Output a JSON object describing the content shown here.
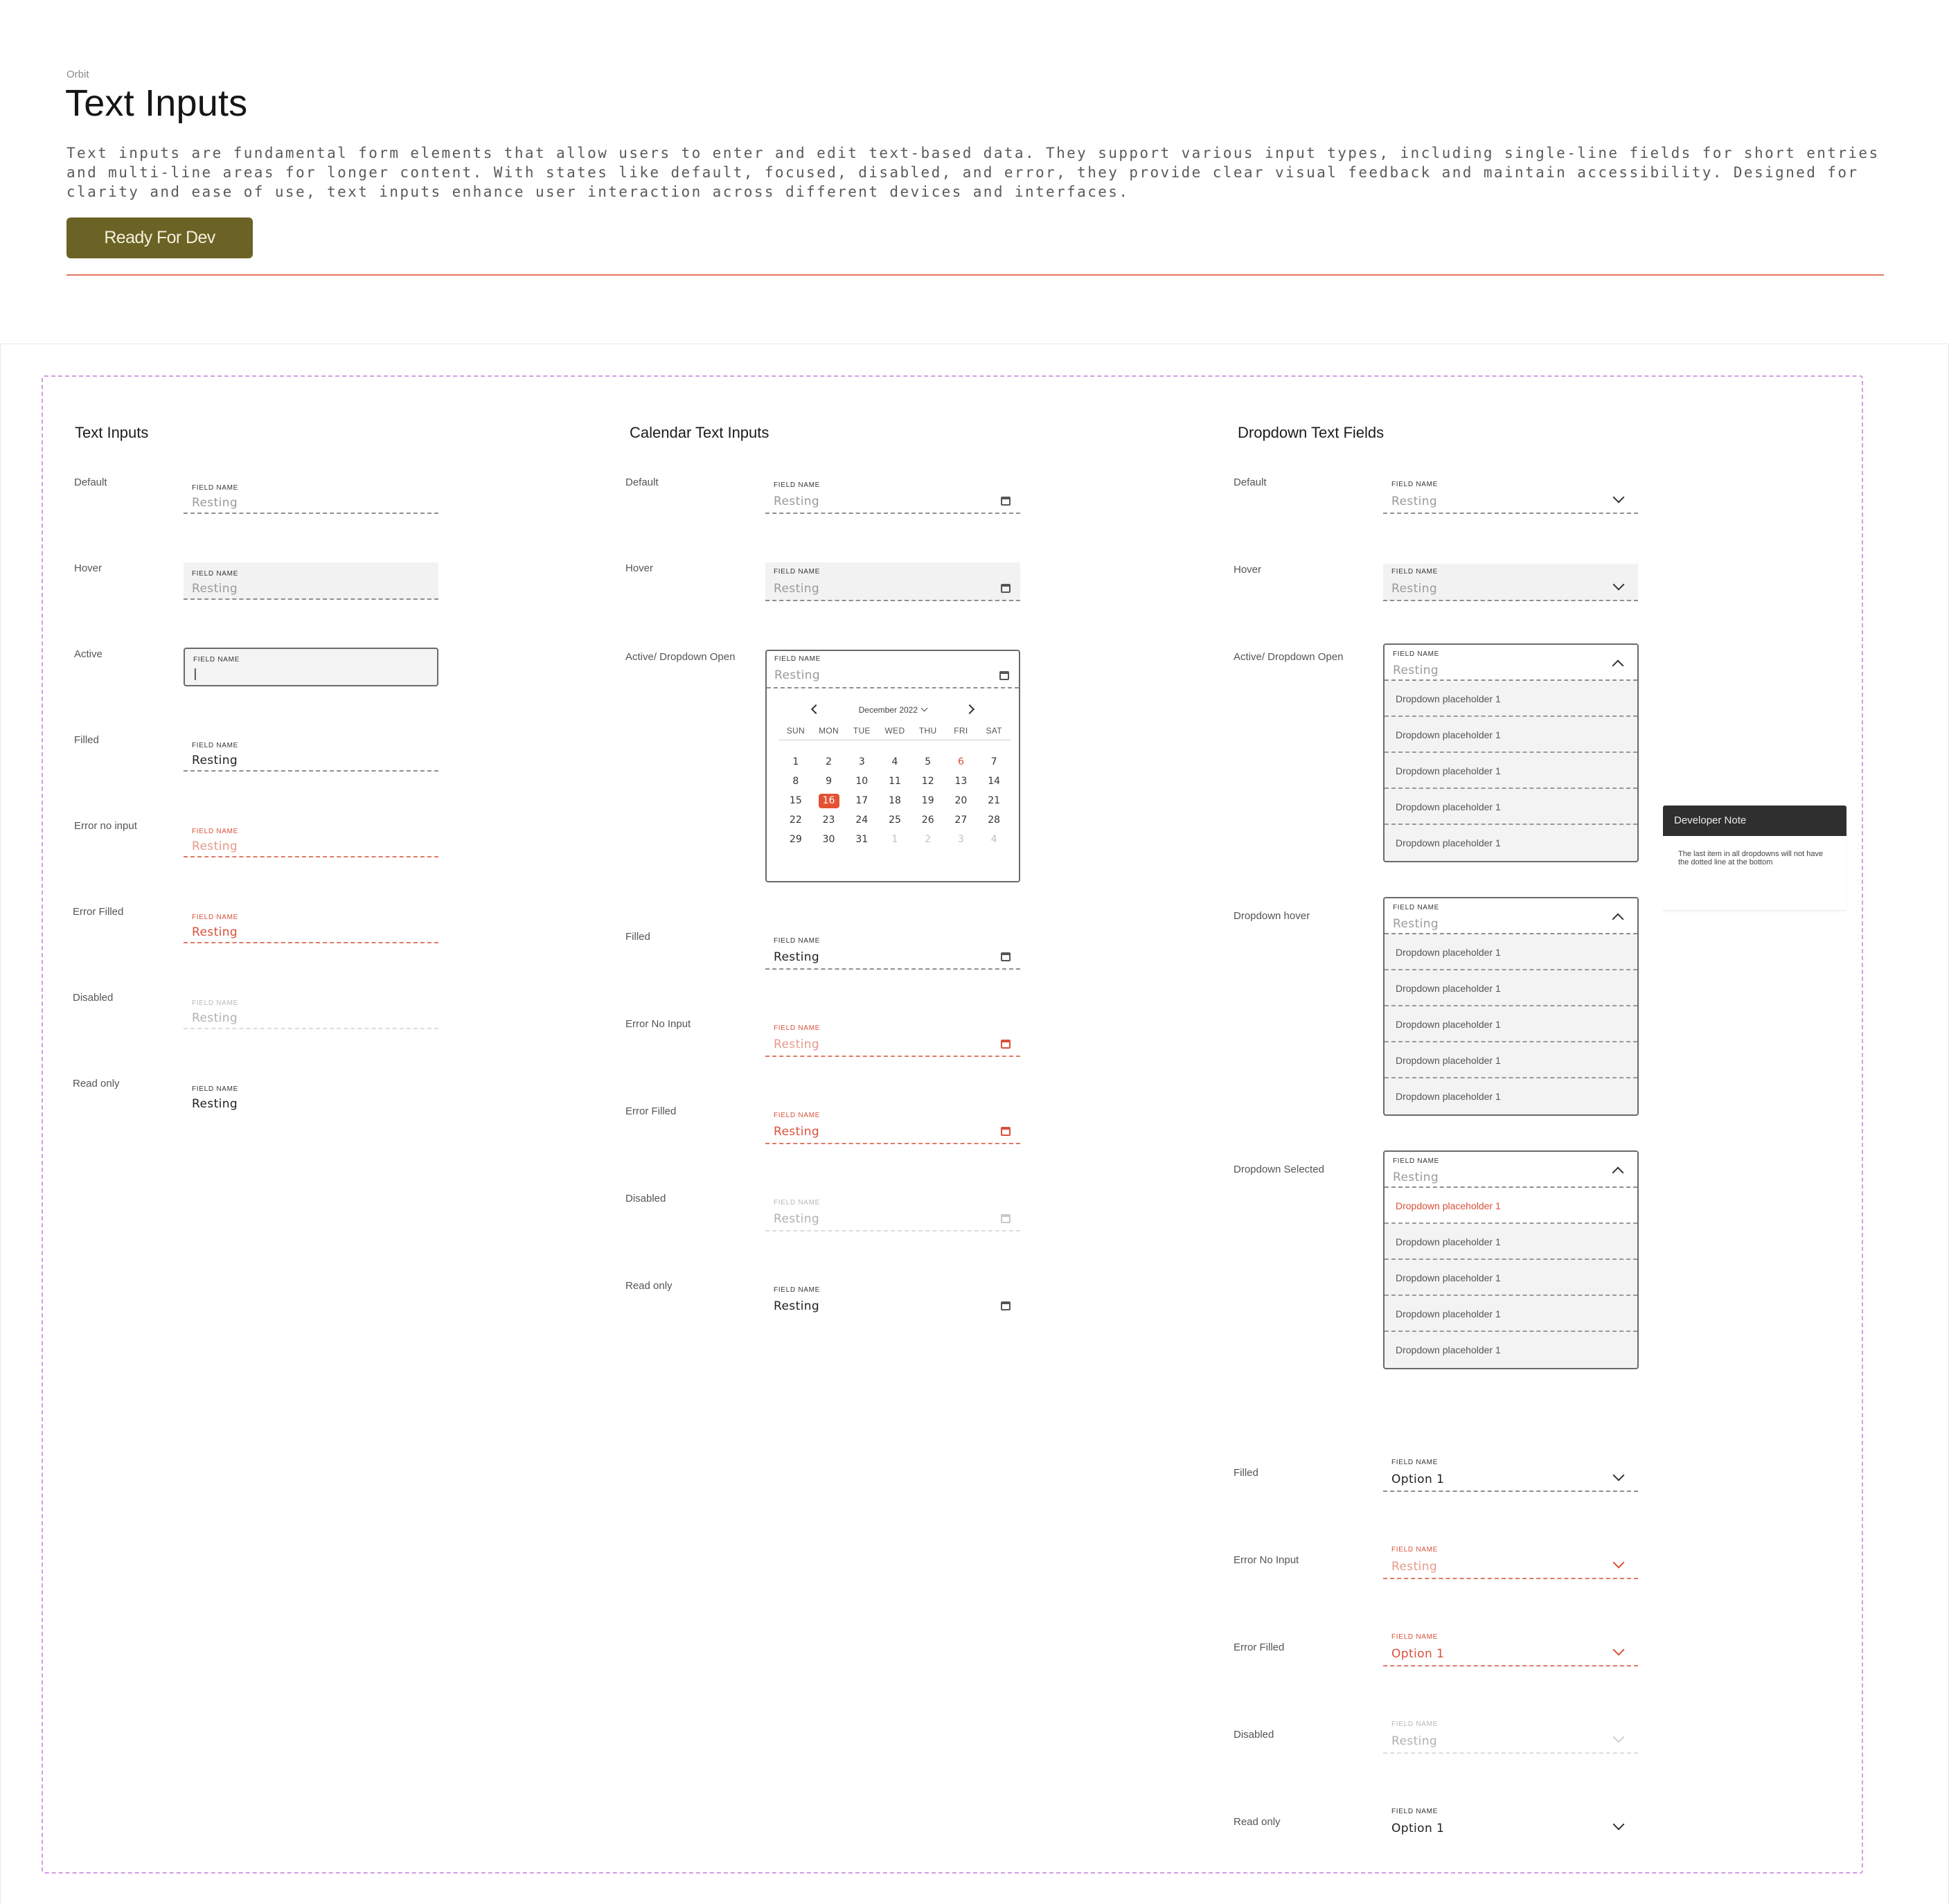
{
  "header": {
    "brand": "Orbit",
    "title": "Text Inputs",
    "description": "Text inputs are fundamental form elements that allow users to enter and edit text-based data. They support various input types, including single-line fields for short entries and multi-line areas for longer content. With states like default, focused, disabled, and error, they provide clear visual feedback and maintain accessibility. Designed for clarity and ease of use, text inputs enhance user interaction across different devices and interfaces.",
    "status_button": "Ready For Dev"
  },
  "colors": {
    "status_button": "#6b6325",
    "divider": "#e0785f",
    "frame_dash": "#d49be3",
    "error": "#d9503a",
    "selected_date": "#e35234"
  },
  "text_inputs": {
    "title": "Text Inputs",
    "field_label": "FIELD NAME",
    "states": {
      "default": {
        "label": "Default",
        "value": "Resting"
      },
      "hover": {
        "label": "Hover",
        "value": "Resting"
      },
      "active": {
        "label": "Active",
        "value": "|"
      },
      "filled": {
        "label": "Filled",
        "value": "Resting"
      },
      "error_no_input": {
        "label": "Error no input",
        "value": "Resting"
      },
      "error_filled": {
        "label": "Error Filled",
        "value": "Resting"
      },
      "disabled": {
        "label": "Disabled",
        "value": "Resting"
      },
      "read_only": {
        "label": "Read only",
        "value": "Resting"
      }
    }
  },
  "calendar_inputs": {
    "title": "Calendar Text Inputs",
    "field_label": "FIELD NAME",
    "icon": "calendar-icon",
    "states": {
      "default": {
        "label": "Default",
        "value": "Resting"
      },
      "hover": {
        "label": "Hover",
        "value": "Resting"
      },
      "active": {
        "label": "Active/ Dropdown Open",
        "value": "Resting"
      },
      "filled": {
        "label": "Filled",
        "value": "Resting"
      },
      "error_no_input": {
        "label": "Error No Input",
        "value": "Resting"
      },
      "error_filled": {
        "label": "Error Filled",
        "value": "Resting"
      },
      "disabled": {
        "label": "Disabled",
        "value": "Resting"
      },
      "read_only": {
        "label": "Read only",
        "value": "Resting"
      }
    },
    "picker": {
      "month": "December 2022",
      "weekdays": [
        "SUN",
        "MON",
        "TUE",
        "WED",
        "THU",
        "FRI",
        "SAT"
      ],
      "dates": [
        [
          "1",
          "2",
          "3",
          "4",
          "5",
          "6",
          "7"
        ],
        [
          "8",
          "9",
          "10",
          "11",
          "12",
          "13",
          "14"
        ],
        [
          "15",
          "16",
          "17",
          "18",
          "19",
          "20",
          "21"
        ],
        [
          "22",
          "23",
          "24",
          "25",
          "26",
          "27",
          "28"
        ],
        [
          "29",
          "30",
          "31",
          "1",
          "2",
          "3",
          "4"
        ]
      ],
      "selected": "16",
      "highlighted": "6"
    }
  },
  "dropdown_fields": {
    "title": "Dropdown Text Fields",
    "field_label": "FIELD NAME",
    "states": {
      "default": {
        "label": "Default",
        "value": "Resting"
      },
      "hover": {
        "label": "Hover",
        "value": "Resting"
      },
      "active": {
        "label": "Active/ Dropdown Open",
        "value": "Resting"
      },
      "dropdown_hover": {
        "label": "Dropdown hover",
        "value": "Resting"
      },
      "dropdown_selected": {
        "label": "Dropdown Selected",
        "value": "Resting"
      },
      "filled": {
        "label": "Filled",
        "value": "Option 1"
      },
      "error_no_input": {
        "label": "Error No Input",
        "value": "Resting"
      },
      "error_filled": {
        "label": "Error Filled",
        "value": "Option 1"
      },
      "disabled": {
        "label": "Disabled",
        "value": "Resting"
      },
      "read_only": {
        "label": "Read only",
        "value": "Option 1"
      }
    },
    "options": [
      "Dropdown placeholder 1",
      "Dropdown placeholder 1",
      "Dropdown placeholder 1",
      "Dropdown placeholder 1",
      "Dropdown placeholder 1"
    ]
  },
  "developer_note": {
    "title": "Developer Note",
    "body": "The last item in all dropdowns will not have the dotted line at the bottom"
  }
}
